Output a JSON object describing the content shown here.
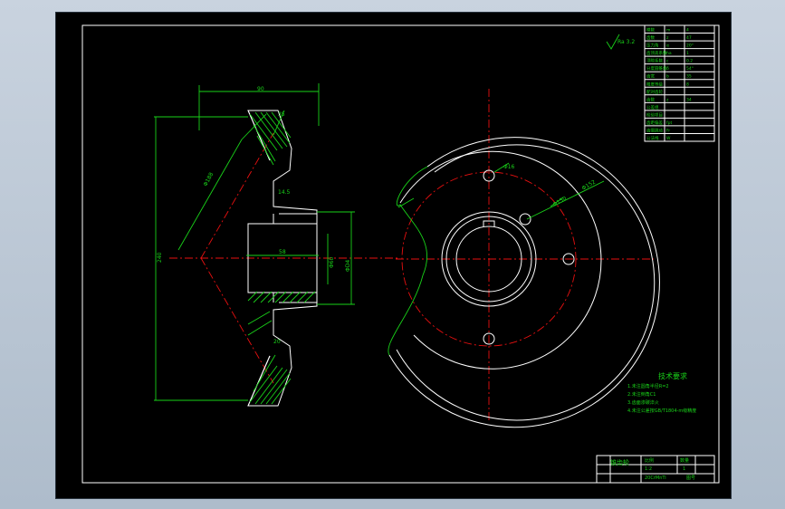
{
  "technical_requirements": {
    "title": "技术要求",
    "items": [
      "1.未注圆角半径R=2",
      "2.未注倒角C1",
      "3.齿面渗碳淬火",
      "4.未注公差按GB/T1804-m级精度"
    ]
  },
  "title_block": {
    "drawing_name": "锥齿轮",
    "label_ratio": "比例",
    "label_qty": "数量",
    "ratio_value": "1:2",
    "qty_value": "1",
    "material": "20CrMnTi",
    "remarks": "图号"
  },
  "gear_params": {
    "rows": [
      [
        "模数",
        "m",
        "4"
      ],
      [
        "齿数",
        "z",
        "47"
      ],
      [
        "压力角",
        "α",
        "20°"
      ],
      [
        "齿顶高系数",
        "ha",
        "1"
      ],
      [
        "顶隙系数",
        "c",
        "0.2"
      ],
      [
        "分度圆锥角",
        "δ",
        "54°"
      ],
      [
        "齿宽",
        "b",
        "35"
      ],
      [
        "精度等级",
        "",
        "8"
      ],
      [
        "配对齿轮",
        "",
        ""
      ],
      [
        "齿数",
        "z",
        "34"
      ],
      [
        "公差组",
        "",
        ""
      ],
      [
        "检验项目",
        "",
        ""
      ],
      [
        "齿距偏差",
        "fpt",
        ""
      ],
      [
        "齿圈跳动",
        "Fr",
        ""
      ],
      [
        "公法线",
        "W",
        ""
      ]
    ]
  },
  "roughness_symbol": "Ra 3.2",
  "dimensions": {
    "overall_length": "90",
    "face_width": "35",
    "hub_len": "58",
    "shaft_dia": "Φ60",
    "cone_dist": "ΦD4",
    "pitch_dia": "Φ188",
    "keyway": "14.5",
    "tip_dia": "240",
    "web": "20",
    "bolt_hole": "Φ16",
    "bolt_circle": "Φ152",
    "pitch_circle": "Φ150"
  }
}
